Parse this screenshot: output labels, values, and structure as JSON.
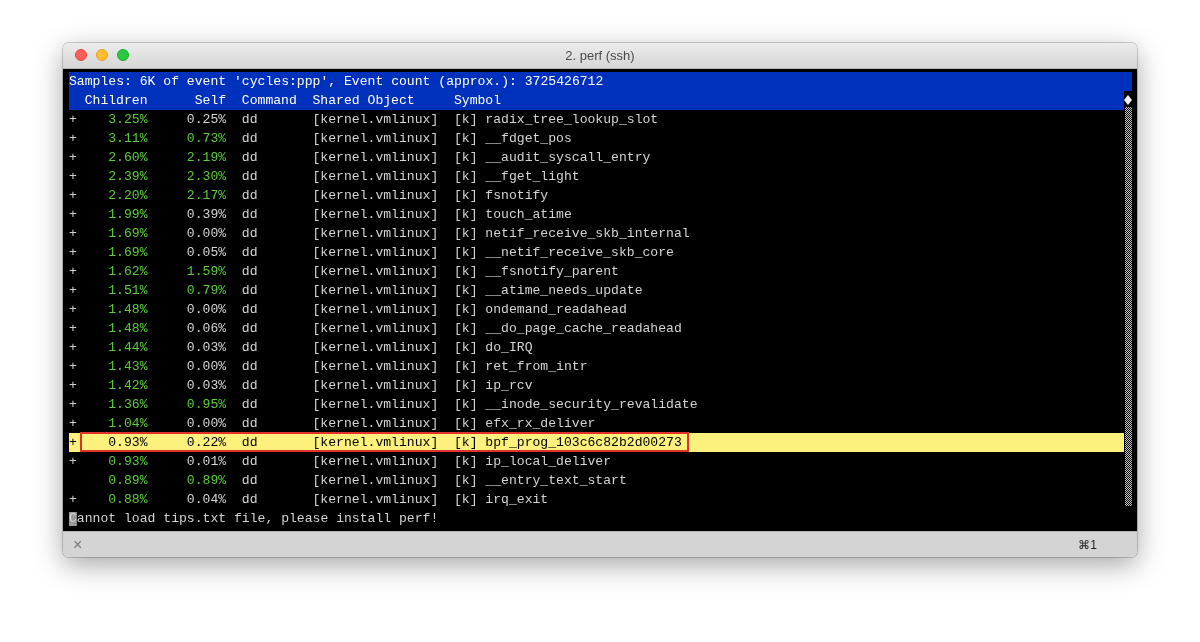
{
  "window": {
    "title": "2. perf (ssh)"
  },
  "report": {
    "summary": "Samples: 6K of event 'cycles:ppp', Event count (approx.): 3725426712",
    "columns": [
      "Children",
      "Self",
      "Command",
      "Shared Object",
      "Symbol"
    ],
    "rows": [
      {
        "expander": "+",
        "children": "3.25%",
        "children_hot": true,
        "self": "0.25%",
        "self_hot": false,
        "command": "dd",
        "shared_object": "[kernel.vmlinux]",
        "privilege": "[k]",
        "symbol": "radix_tree_lookup_slot",
        "selected": false,
        "annotated": false
      },
      {
        "expander": "+",
        "children": "3.11%",
        "children_hot": true,
        "self": "0.73%",
        "self_hot": true,
        "command": "dd",
        "shared_object": "[kernel.vmlinux]",
        "privilege": "[k]",
        "symbol": "__fdget_pos",
        "selected": false,
        "annotated": false
      },
      {
        "expander": "+",
        "children": "2.60%",
        "children_hot": true,
        "self": "2.19%",
        "self_hot": true,
        "command": "dd",
        "shared_object": "[kernel.vmlinux]",
        "privilege": "[k]",
        "symbol": "__audit_syscall_entry",
        "selected": false,
        "annotated": false
      },
      {
        "expander": "+",
        "children": "2.39%",
        "children_hot": true,
        "self": "2.30%",
        "self_hot": true,
        "command": "dd",
        "shared_object": "[kernel.vmlinux]",
        "privilege": "[k]",
        "symbol": "__fget_light",
        "selected": false,
        "annotated": false
      },
      {
        "expander": "+",
        "children": "2.20%",
        "children_hot": true,
        "self": "2.17%",
        "self_hot": true,
        "command": "dd",
        "shared_object": "[kernel.vmlinux]",
        "privilege": "[k]",
        "symbol": "fsnotify",
        "selected": false,
        "annotated": false
      },
      {
        "expander": "+",
        "children": "1.99%",
        "children_hot": true,
        "self": "0.39%",
        "self_hot": false,
        "command": "dd",
        "shared_object": "[kernel.vmlinux]",
        "privilege": "[k]",
        "symbol": "touch_atime",
        "selected": false,
        "annotated": false
      },
      {
        "expander": "+",
        "children": "1.69%",
        "children_hot": true,
        "self": "0.00%",
        "self_hot": false,
        "command": "dd",
        "shared_object": "[kernel.vmlinux]",
        "privilege": "[k]",
        "symbol": "netif_receive_skb_internal",
        "selected": false,
        "annotated": false
      },
      {
        "expander": "+",
        "children": "1.69%",
        "children_hot": true,
        "self": "0.05%",
        "self_hot": false,
        "command": "dd",
        "shared_object": "[kernel.vmlinux]",
        "privilege": "[k]",
        "symbol": "__netif_receive_skb_core",
        "selected": false,
        "annotated": false
      },
      {
        "expander": "+",
        "children": "1.62%",
        "children_hot": true,
        "self": "1.59%",
        "self_hot": true,
        "command": "dd",
        "shared_object": "[kernel.vmlinux]",
        "privilege": "[k]",
        "symbol": "__fsnotify_parent",
        "selected": false,
        "annotated": false
      },
      {
        "expander": "+",
        "children": "1.51%",
        "children_hot": true,
        "self": "0.79%",
        "self_hot": true,
        "command": "dd",
        "shared_object": "[kernel.vmlinux]",
        "privilege": "[k]",
        "symbol": "__atime_needs_update",
        "selected": false,
        "annotated": false
      },
      {
        "expander": "+",
        "children": "1.48%",
        "children_hot": true,
        "self": "0.00%",
        "self_hot": false,
        "command": "dd",
        "shared_object": "[kernel.vmlinux]",
        "privilege": "[k]",
        "symbol": "ondemand_readahead",
        "selected": false,
        "annotated": false
      },
      {
        "expander": "+",
        "children": "1.48%",
        "children_hot": true,
        "self": "0.06%",
        "self_hot": false,
        "command": "dd",
        "shared_object": "[kernel.vmlinux]",
        "privilege": "[k]",
        "symbol": "__do_page_cache_readahead",
        "selected": false,
        "annotated": false
      },
      {
        "expander": "+",
        "children": "1.44%",
        "children_hot": true,
        "self": "0.03%",
        "self_hot": false,
        "command": "dd",
        "shared_object": "[kernel.vmlinux]",
        "privilege": "[k]",
        "symbol": "do_IRQ",
        "selected": false,
        "annotated": false
      },
      {
        "expander": "+",
        "children": "1.43%",
        "children_hot": true,
        "self": "0.00%",
        "self_hot": false,
        "command": "dd",
        "shared_object": "[kernel.vmlinux]",
        "privilege": "[k]",
        "symbol": "ret_from_intr",
        "selected": false,
        "annotated": false
      },
      {
        "expander": "+",
        "children": "1.42%",
        "children_hot": true,
        "self": "0.03%",
        "self_hot": false,
        "command": "dd",
        "shared_object": "[kernel.vmlinux]",
        "privilege": "[k]",
        "symbol": "ip_rcv",
        "selected": false,
        "annotated": false
      },
      {
        "expander": "+",
        "children": "1.36%",
        "children_hot": true,
        "self": "0.95%",
        "self_hot": true,
        "command": "dd",
        "shared_object": "[kernel.vmlinux]",
        "privilege": "[k]",
        "symbol": "__inode_security_revalidate",
        "selected": false,
        "annotated": false
      },
      {
        "expander": "+",
        "children": "1.04%",
        "children_hot": true,
        "self": "0.00%",
        "self_hot": false,
        "command": "dd",
        "shared_object": "[kernel.vmlinux]",
        "privilege": "[k]",
        "symbol": "efx_rx_deliver",
        "selected": false,
        "annotated": false
      },
      {
        "expander": "+",
        "children": "0.93%",
        "self": "0.22%",
        "command": "dd",
        "shared_object": "[kernel.vmlinux]",
        "privilege": "[k]",
        "symbol": "bpf_prog_103c6c82b2d00273",
        "selected": true,
        "annotated": true
      },
      {
        "expander": "+",
        "children": "0.93%",
        "children_hot": true,
        "self": "0.01%",
        "self_hot": false,
        "command": "dd",
        "shared_object": "[kernel.vmlinux]",
        "privilege": "[k]",
        "symbol": "ip_local_deliver",
        "selected": false,
        "annotated": false
      },
      {
        "children": "0.89%",
        "children_hot": true,
        "self": "0.89%",
        "self_hot": true,
        "command": "dd",
        "shared_object": "[kernel.vmlinux]",
        "privilege": "[k]",
        "symbol": "__entry_text_start",
        "selected": false,
        "annotated": false
      },
      {
        "expander": "+",
        "children": "0.88%",
        "children_hot": true,
        "self": "0.04%",
        "self_hot": false,
        "command": "dd",
        "shared_object": "[kernel.vmlinux]",
        "privilege": "[k]",
        "symbol": "irq_exit",
        "selected": false,
        "annotated": false
      }
    ]
  },
  "message": "Cannot load tips.txt file, please install perf!",
  "tab_bar": {
    "close": "×",
    "shortcut": "⌘1"
  }
}
